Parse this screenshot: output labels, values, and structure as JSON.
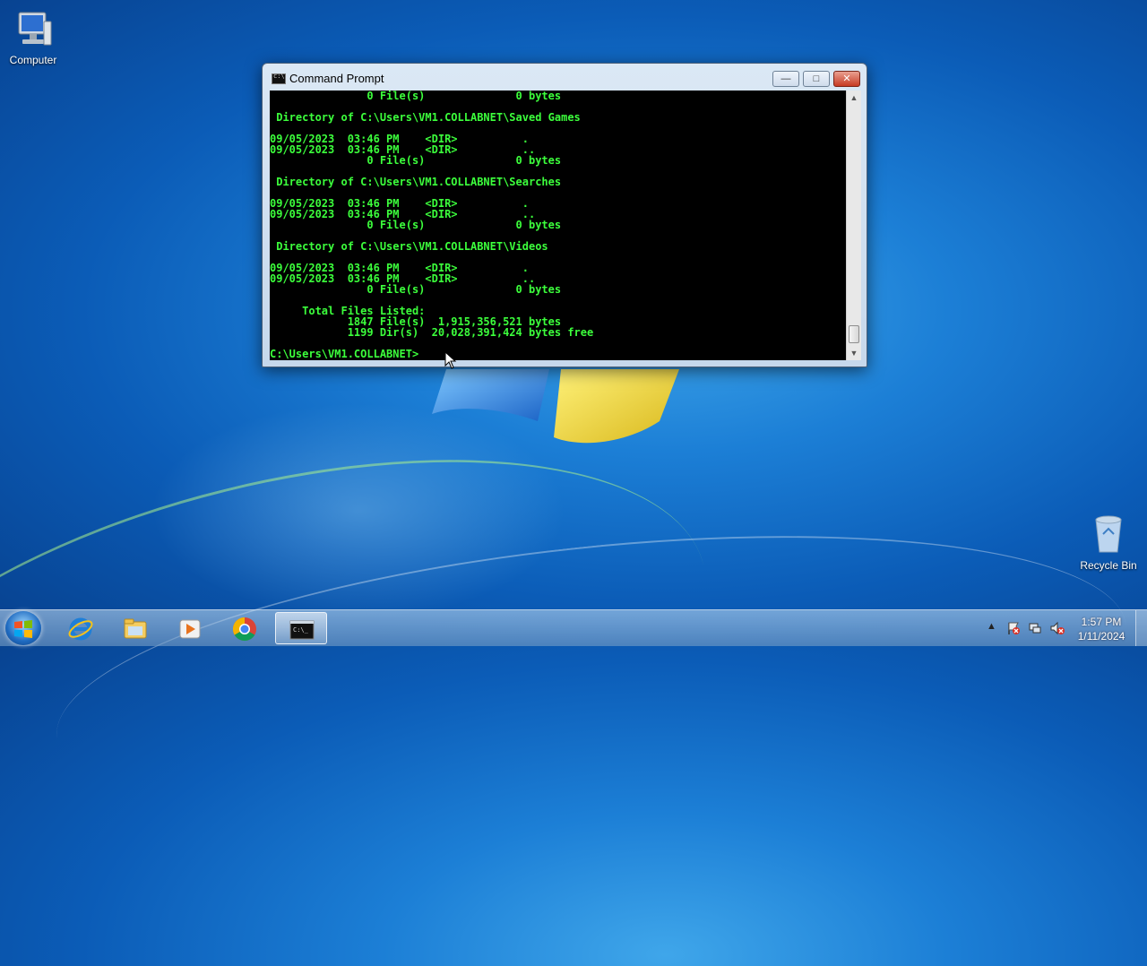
{
  "desktop": {
    "icons": [
      {
        "label": "Computer",
        "icon": "computer-icon"
      },
      {
        "label": "Recycle Bin",
        "icon": "recycle-bin-icon"
      }
    ]
  },
  "window": {
    "title": "Command Prompt",
    "controls": {
      "minimize": "—",
      "maximize": "□",
      "close": "✕"
    }
  },
  "console": {
    "lines": [
      "               0 File(s)              0 bytes",
      "",
      " Directory of C:\\Users\\VM1.COLLABNET\\Saved Games",
      "",
      "09/05/2023  03:46 PM    <DIR>          .",
      "09/05/2023  03:46 PM    <DIR>          ..",
      "               0 File(s)              0 bytes",
      "",
      " Directory of C:\\Users\\VM1.COLLABNET\\Searches",
      "",
      "09/05/2023  03:46 PM    <DIR>          .",
      "09/05/2023  03:46 PM    <DIR>          ..",
      "               0 File(s)              0 bytes",
      "",
      " Directory of C:\\Users\\VM1.COLLABNET\\Videos",
      "",
      "09/05/2023  03:46 PM    <DIR>          .",
      "09/05/2023  03:46 PM    <DIR>          ..",
      "               0 File(s)              0 bytes",
      "",
      "     Total Files Listed:",
      "            1847 File(s)  1,915,356,521 bytes",
      "            1199 Dir(s)  20,028,391,424 bytes free",
      "",
      "C:\\Users\\VM1.COLLABNET>"
    ]
  },
  "taskbar": {
    "apps": [
      "internet-explorer-icon",
      "windows-explorer-icon",
      "media-player-icon",
      "chrome-icon",
      "command-prompt-icon"
    ],
    "active_app": "command-prompt-icon",
    "tray": {
      "show_hidden": "▲"
    },
    "clock": {
      "time": "1:57 PM",
      "date": "1/11/2024"
    }
  },
  "colors": {
    "console_text": "#3cff3c",
    "console_bg": "#000000",
    "desktop_bg": "#0b5cb7"
  }
}
